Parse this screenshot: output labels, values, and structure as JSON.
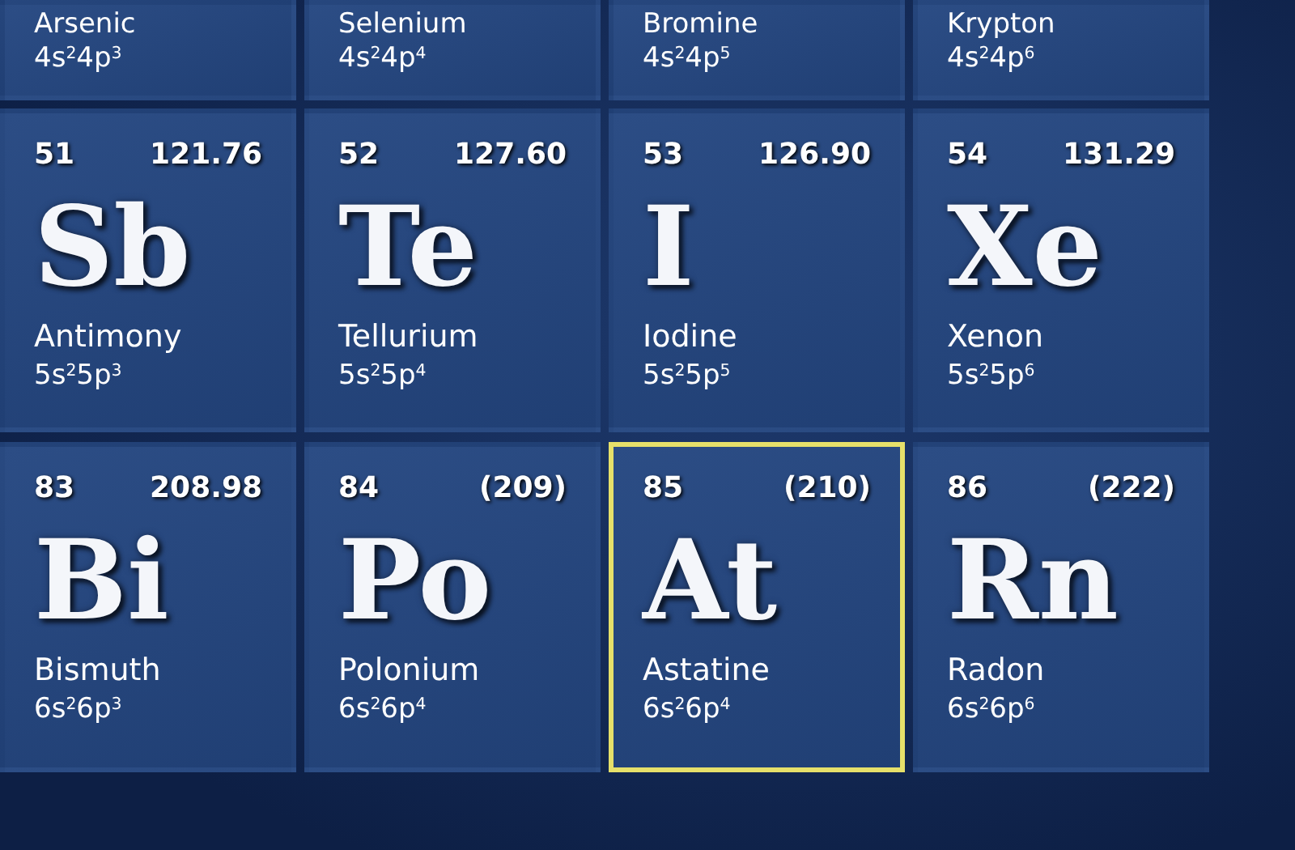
{
  "rows": [
    {
      "elements": [
        {
          "name": "Arsenic",
          "configuration": "4s$^{2}$4p$^{3}$",
          "selected": false
        },
        {
          "name": "Selenium",
          "configuration": "4s$^{2}$4p$^{4}$",
          "selected": false
        },
        {
          "name": "Bromine",
          "configuration": "4s$^{2}$4p$^{5}$",
          "selected": false
        },
        {
          "name": "Krypton",
          "configuration": "4s$^{2}$4p$^{6}$",
          "selected": false
        }
      ]
    },
    {
      "elements": [
        {
          "number": "51",
          "mass": "121.76",
          "symbol": "Sb",
          "name": "Antimony",
          "configuration": "5s$^{2}$5p$^{3}$",
          "selected": false
        },
        {
          "number": "52",
          "mass": "127.60",
          "symbol": "Te",
          "name": "Tellurium",
          "configuration": "5s$^{2}$5p$^{4}$",
          "selected": false
        },
        {
          "number": "53",
          "mass": "126.90",
          "symbol": "I",
          "name": "Iodine",
          "configuration": "5s$^{2}$5p$^{5}$",
          "selected": false
        },
        {
          "number": "54",
          "mass": "131.29",
          "symbol": "Xe",
          "name": "Xenon",
          "configuration": "5s$^{2}$5p$^{6}$",
          "selected": false
        }
      ]
    },
    {
      "elements": [
        {
          "number": "83",
          "mass": "208.98",
          "symbol": "Bi",
          "name": "Bismuth",
          "configuration": "6s$^{2}$6p$^{3}$",
          "selected": false
        },
        {
          "number": "84",
          "mass": "(209)",
          "symbol": "Po",
          "name": "Polonium",
          "configuration": "6s$^{2}$6p$^{4}$",
          "selected": false
        },
        {
          "number": "85",
          "mass": "(210)",
          "symbol": "At",
          "name": "Astatine",
          "configuration": "6s$^{2}$6p$^{4}$",
          "selected": true
        },
        {
          "number": "86",
          "mass": "(222)",
          "symbol": "Rn",
          "name": "Radon",
          "configuration": "6s$^{2}$6p$^{6}$",
          "selected": false
        }
      ]
    }
  ]
}
